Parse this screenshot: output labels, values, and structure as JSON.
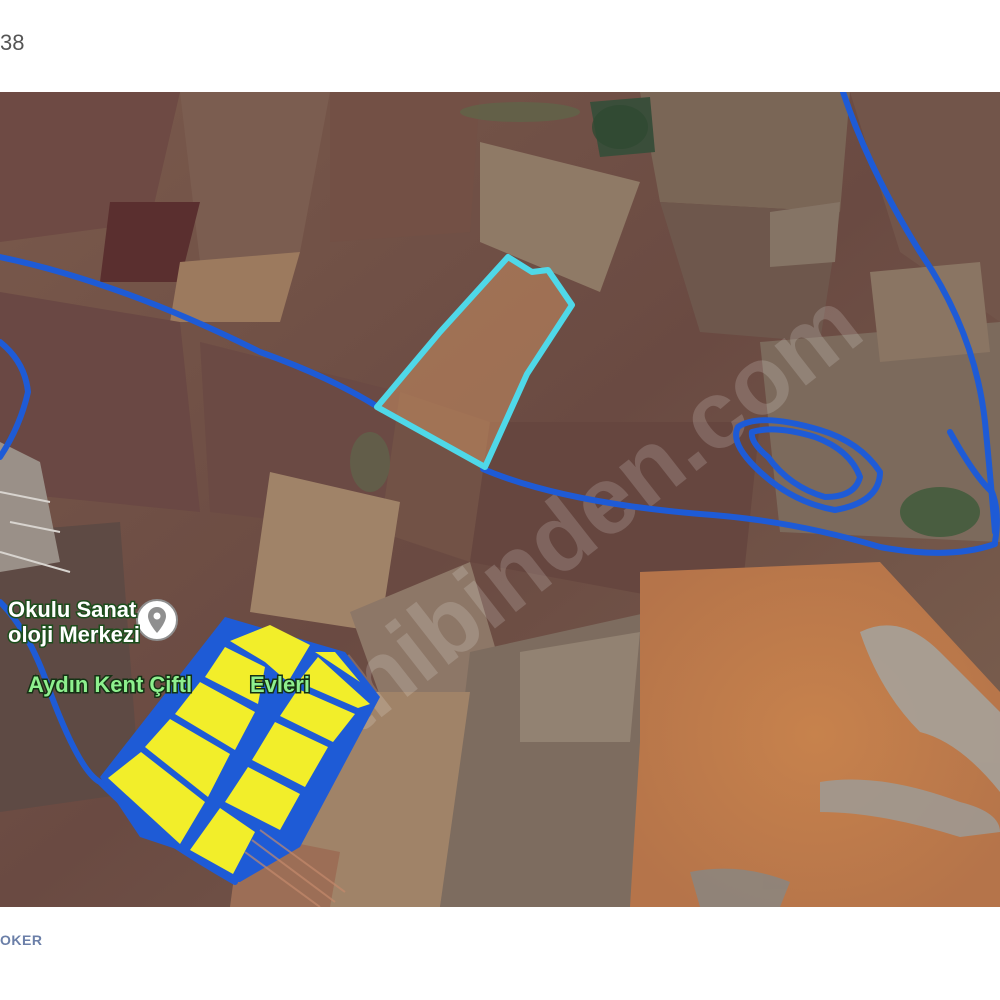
{
  "header": {
    "text": "38"
  },
  "footer": {
    "text": "OKER"
  },
  "map": {
    "view": "satellite",
    "watermark": "sahibinden.com",
    "poi": {
      "label_line1": "Okulu Sanat",
      "label_line2": "oloji Merkezi",
      "icon": "map-pin-icon"
    },
    "place_label": "Aydın Kent Çiftl",
    "place_label_tail": "Evleri",
    "colors": {
      "parcel_outline": "#1e5bd6",
      "selected_parcel": "#4fd8e8",
      "lot_fill": "#f2ee2a"
    }
  }
}
